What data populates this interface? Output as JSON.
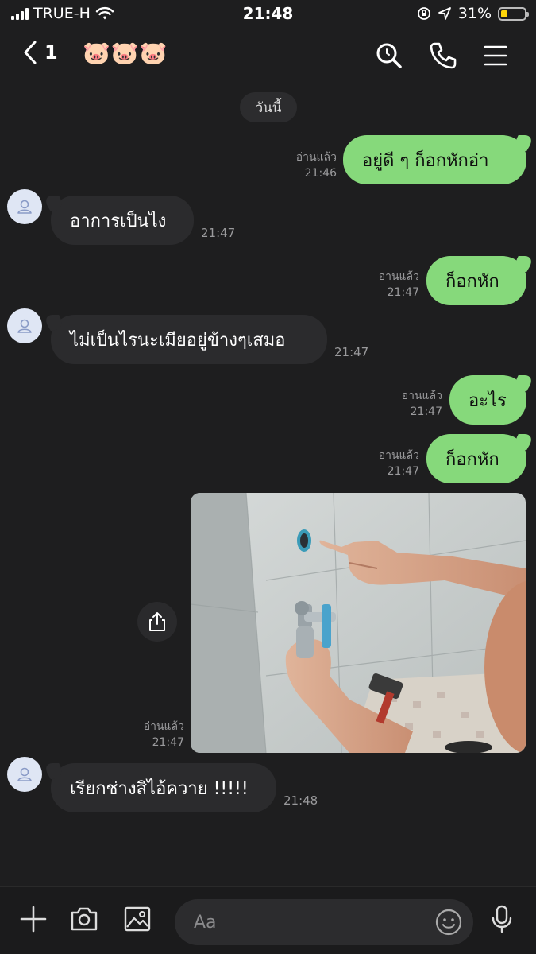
{
  "status": {
    "carrier": "TRUE-H",
    "time": "21:48",
    "battery": "31%",
    "battery_level": 0.31
  },
  "header": {
    "back_count": "1",
    "title": "🐷🐷🐷"
  },
  "chat": {
    "date_label": "วันนี้",
    "messages": [
      {
        "side": "out",
        "text": "อยู่ดี ๆ ก็อกหักอ่า",
        "read": "อ่านแล้ว",
        "time": "21:46"
      },
      {
        "side": "in",
        "text": "อาการเป็นไง",
        "time": "21:47"
      },
      {
        "side": "out",
        "text": "ก็อกหัก",
        "read": "อ่านแล้ว",
        "time": "21:47"
      },
      {
        "side": "in",
        "text": "ไม่เป็นไรนะเมียอยู่ข้างๆเสมอ",
        "time": "21:47"
      },
      {
        "side": "out",
        "text": "อะไร",
        "read": "อ่านแล้ว",
        "time": "21:47"
      },
      {
        "side": "out",
        "text": "ก็อกหัก",
        "read": "อ่านแล้ว",
        "time": "21:47"
      },
      {
        "side": "out",
        "type": "image",
        "read": "อ่านแล้ว",
        "time": "21:47",
        "image_icon": "broken-faucet-photo"
      },
      {
        "side": "in",
        "text": "เรียกช่างสิไอ้ควาย !!!!!",
        "time": "21:48"
      }
    ]
  },
  "input": {
    "placeholder": "Aa"
  },
  "colors": {
    "outgoing_bubble": "#86d97b",
    "incoming_bubble": "#2b2b2d",
    "background": "#1e1e1f"
  }
}
